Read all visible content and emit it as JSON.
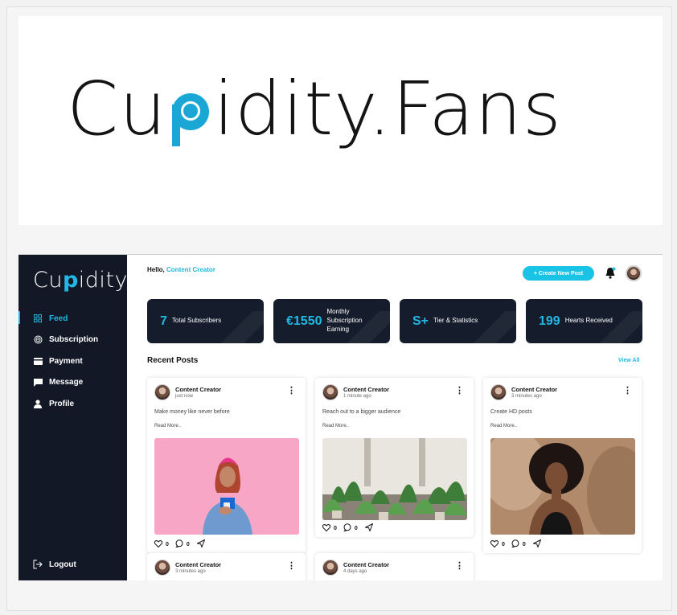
{
  "brand": {
    "banner_left": "Cu",
    "banner_right": "idity.Fans",
    "sidebar_left": "Cu",
    "sidebar_p": "p",
    "sidebar_right": "idity",
    "accent": "#21b8e4",
    "dark": "#121826"
  },
  "sidebar": {
    "items": [
      {
        "label": "Feed",
        "icon": "grid-icon",
        "active": true
      },
      {
        "label": "Subscription",
        "icon": "target-icon"
      },
      {
        "label": "Payment",
        "icon": "card-icon"
      },
      {
        "label": "Message",
        "icon": "message-icon"
      },
      {
        "label": "Profile",
        "icon": "user-icon"
      }
    ],
    "logout": "Logout"
  },
  "header": {
    "greeting": "Hello,",
    "user": "Content Creator",
    "create_button": "+ Create New Post"
  },
  "stats": [
    {
      "value": "7",
      "label": "Total Subscribers"
    },
    {
      "value": "€1550",
      "label": "Monthly Subscription Earning"
    },
    {
      "value": "S+",
      "label": "Tier & Statistics"
    },
    {
      "value": "199",
      "label": "Hearts Received"
    }
  ],
  "recent": {
    "title": "Recent Posts",
    "view_all": "View All"
  },
  "posts": [
    {
      "author": "Content Creator",
      "time": "just now",
      "text": "Make money like never before",
      "more": "Read More..",
      "likes": "0",
      "comments": "0"
    },
    {
      "author": "Content Creator",
      "time": "1 minute ago",
      "text": "Reach out to a bigger audience",
      "more": "Read More..",
      "likes": "0",
      "comments": "0"
    },
    {
      "author": "Content Creator",
      "time": "3 minutes ago",
      "text": "Create HD posts",
      "more": "Read More..",
      "likes": "0",
      "comments": "0"
    },
    {
      "author": "Content Creator",
      "time": "3 minutes ago"
    },
    {
      "author": "Content Creator",
      "time": "4 days ago"
    }
  ]
}
